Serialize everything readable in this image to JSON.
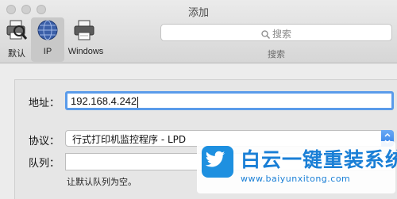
{
  "window": {
    "title": "添加"
  },
  "toolbar": {
    "items": [
      {
        "label": "默认",
        "icon": "default-printer-icon",
        "selected": false
      },
      {
        "label": "IP",
        "icon": "ip-globe-icon",
        "selected": true
      },
      {
        "label": "Windows",
        "icon": "windows-printer-icon",
        "selected": false
      }
    ],
    "search": {
      "placeholder": "搜索",
      "caption": "搜索"
    }
  },
  "form": {
    "address": {
      "label": "地址：",
      "value": "192.168.4.242"
    },
    "protocol": {
      "label": "协议：",
      "value": "行式打印机监控程序 - LPD"
    },
    "queue": {
      "label": "队列：",
      "value": "",
      "hint": "让默认队列为空。"
    }
  },
  "watermark": {
    "brand": "白云一键重装系统",
    "url": "www.baiyunxitong.com"
  },
  "colors": {
    "accent": "#5a9bea",
    "brand": "#1a7fd6"
  }
}
